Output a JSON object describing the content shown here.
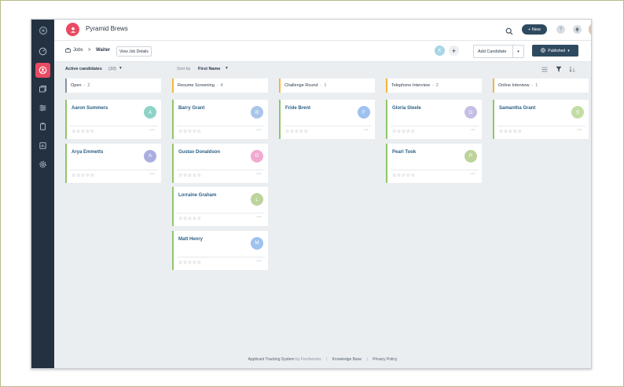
{
  "header": {
    "brand": "Pyramid Brews",
    "new_label": "+ New",
    "help_label": "?"
  },
  "subheader": {
    "breadcrumb_jobs": "Jobs",
    "breadcrumb_sep": ">",
    "breadcrumb_current": "Waiter",
    "view_job_details": "View Job Details",
    "member_initial": "K",
    "add_member": "+",
    "add_candidate": "Add Candidate",
    "published": "Published"
  },
  "filters": {
    "active_label": "Active candidates",
    "active_count": "(10)",
    "sort_by": "Sort by",
    "sort_value": "First Name"
  },
  "columns": [
    {
      "title": "Open",
      "count": "2",
      "bar_color": "#8593a1",
      "cards": [
        {
          "name": "Aaron Summers",
          "initial": "A",
          "avatar_color": "#8ed3c8"
        },
        {
          "name": "Arya Emmetts",
          "initial": "A",
          "avatar_color": "#a9aee0"
        }
      ]
    },
    {
      "title": "Resume Screening",
      "count": "4",
      "bar_color": "#f2b53f",
      "cards": [
        {
          "name": "Barry Grant",
          "initial": "B",
          "avatar_color": "#a9c6ea"
        },
        {
          "name": "Gustav Donaldson",
          "initial": "G",
          "avatar_color": "#f1a9d2"
        },
        {
          "name": "Lorraine Graham",
          "initial": "L",
          "avatar_color": "#bcd39c"
        },
        {
          "name": "Matt Henry",
          "initial": "M",
          "avatar_color": "#9dc2f0"
        }
      ]
    },
    {
      "title": "Challenge Round",
      "count": "1",
      "bar_color": "#f2b53f",
      "cards": [
        {
          "name": "Fride Brent",
          "initial": "F",
          "avatar_color": "#9dc2f0"
        }
      ]
    },
    {
      "title": "Telephone Interview",
      "count": "2",
      "bar_color": "#f2b53f",
      "cards": [
        {
          "name": "Gloria Steele",
          "initial": "G",
          "avatar_color": "#c4bfe6"
        },
        {
          "name": "Pearl Took",
          "initial": "P",
          "avatar_color": "#bcd39c"
        }
      ]
    },
    {
      "title": "Online Interview",
      "count": "1",
      "bar_color": "#f2b53f",
      "cards": [
        {
          "name": "Samantha Grant",
          "initial": "S",
          "avatar_color": "#c3dca4"
        }
      ]
    }
  ],
  "card_stars": "☆☆☆☆☆",
  "card_more": "···",
  "footer": {
    "product": "Applicant Tracking System",
    "by": "by Freshworks",
    "kb": "Knowledge Base",
    "privacy": "Privacy Policy"
  },
  "colors": {
    "accent": "#e94b62",
    "sidebar": "#233140",
    "primary_button": "#2e4a5f",
    "card_border": "#8fc66a",
    "link": "#2a5f86"
  }
}
